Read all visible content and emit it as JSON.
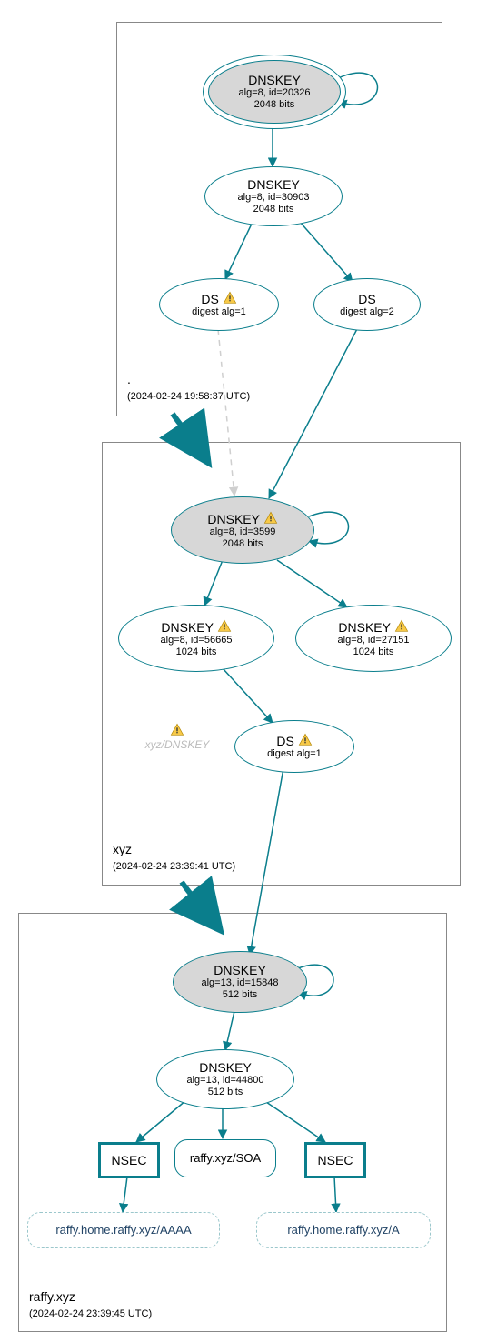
{
  "zones": {
    "root": {
      "label": ".",
      "timestamp": "(2024-02-24 19:58:37 UTC)"
    },
    "tld": {
      "label": "xyz",
      "timestamp": "(2024-02-24 23:39:41 UTC)"
    },
    "domain": {
      "label": "raffy.xyz",
      "timestamp": "(2024-02-24 23:39:45 UTC)"
    }
  },
  "nodes": {
    "root_ksk": {
      "title": "DNSKEY",
      "line2": "alg=8, id=20326",
      "line3": "2048 bits"
    },
    "root_zsk": {
      "title": "DNSKEY",
      "line2": "alg=8, id=30903",
      "line3": "2048 bits"
    },
    "root_ds1": {
      "title": "DS",
      "line2": "digest alg=1",
      "warn": true
    },
    "root_ds2": {
      "title": "DS",
      "line2": "digest alg=2"
    },
    "tld_ksk": {
      "title": "DNSKEY",
      "line2": "alg=8, id=3599",
      "line3": "2048 bits",
      "warn": true
    },
    "tld_zsk_a": {
      "title": "DNSKEY",
      "line2": "alg=8, id=56665",
      "line3": "1024 bits",
      "warn": true
    },
    "tld_zsk_b": {
      "title": "DNSKEY",
      "line2": "alg=8, id=27151",
      "line3": "1024 bits",
      "warn": true
    },
    "tld_ds": {
      "title": "DS",
      "line2": "digest alg=1",
      "warn": true
    },
    "ghost": {
      "text": "xyz/DNSKEY",
      "warn": true
    },
    "dom_ksk": {
      "title": "DNSKEY",
      "line2": "alg=13, id=15848",
      "line3": "512 bits"
    },
    "dom_zsk": {
      "title": "DNSKEY",
      "line2": "alg=13, id=44800",
      "line3": "512 bits"
    },
    "nsec_l": {
      "title": "NSEC"
    },
    "nsec_r": {
      "title": "NSEC"
    },
    "soa": {
      "title": "raffy.xyz/SOA"
    },
    "neg_aaaa": {
      "title": "raffy.home.raffy.xyz/AAAA"
    },
    "neg_a": {
      "title": "raffy.home.raffy.xyz/A"
    }
  },
  "colors": {
    "stroke": "#0a7e8c"
  }
}
